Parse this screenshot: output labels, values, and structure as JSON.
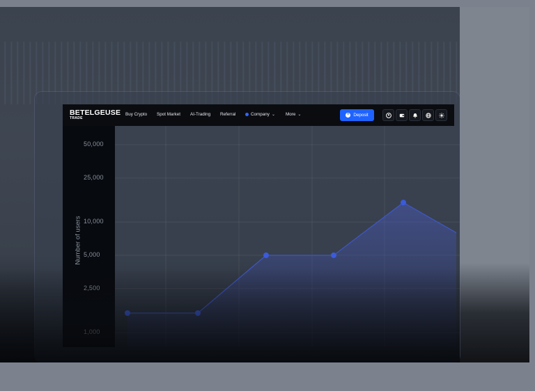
{
  "brand": {
    "name": "BETELGEUSE",
    "sub": "TRADE"
  },
  "nav": {
    "items": [
      {
        "label": "Buy Crypto"
      },
      {
        "label": "Spot Market"
      },
      {
        "label": "AI-Trading"
      },
      {
        "label": "Referral"
      },
      {
        "label": "Company"
      },
      {
        "label": "More"
      }
    ],
    "deposit_label": "Deposit"
  },
  "icons": [
    "user-icon",
    "wallet-icon",
    "notification-icon",
    "globe-icon",
    "sun-icon"
  ],
  "colors": {
    "accent": "#1f63ff",
    "nav_bg": "#0a0c10",
    "series": "#3b5bdb"
  },
  "chart_data": {
    "type": "area",
    "ylabel": "Number of users",
    "yscale": "log",
    "yticks": [
      "50,000",
      "25,000",
      "10,000",
      "5,000",
      "2,500",
      "1,000"
    ],
    "ytick_values": [
      50000,
      25000,
      10000,
      5000,
      2500,
      1000
    ],
    "series": [
      {
        "values": [
          1500,
          1500,
          5000,
          5000,
          15000,
          8000
        ]
      }
    ],
    "grid": true
  }
}
